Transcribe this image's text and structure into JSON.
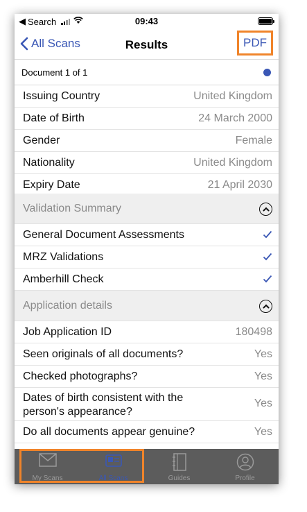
{
  "status": {
    "carrier": "Search",
    "time": "09:43"
  },
  "nav": {
    "back_label": "All Scans",
    "title": "Results",
    "pdf_label": "PDF"
  },
  "doc": {
    "label": "Document 1 of 1"
  },
  "details": [
    {
      "key": "Issuing Country",
      "value": "United Kingdom"
    },
    {
      "key": "Date of Birth",
      "value": "24 March 2000"
    },
    {
      "key": "Gender",
      "value": "Female"
    },
    {
      "key": "Nationality",
      "value": "United Kingdom"
    },
    {
      "key": "Expiry Date",
      "value": "21 April 2030"
    }
  ],
  "validation": {
    "title": "Validation Summary",
    "items": [
      {
        "label": "General Document Assessments"
      },
      {
        "label": "MRZ Validations"
      },
      {
        "label": "Amberhill Check"
      }
    ]
  },
  "application": {
    "title": "Application details",
    "items": [
      {
        "key": "Job Application ID",
        "value": "180498"
      },
      {
        "key": "Seen originals of all documents?",
        "value": "Yes"
      },
      {
        "key": "Checked photographs?",
        "value": "Yes"
      },
      {
        "key": "Dates of birth consistent with the person's appearance?",
        "value": "Yes"
      },
      {
        "key": "Do all documents appear genuine?",
        "value": "Yes"
      }
    ]
  },
  "tabs": [
    {
      "label": "My Scans",
      "icon": "envelope-icon"
    },
    {
      "label": "All Scans",
      "icon": "scan-card-icon"
    },
    {
      "label": "Guides",
      "icon": "notebook-icon"
    },
    {
      "label": "Profile",
      "icon": "user-circle-icon"
    }
  ],
  "colors": {
    "accent": "#3a57b5",
    "highlight": "#f0842a",
    "tabbar": "#5c5c5c",
    "section_bg": "#efefef"
  }
}
